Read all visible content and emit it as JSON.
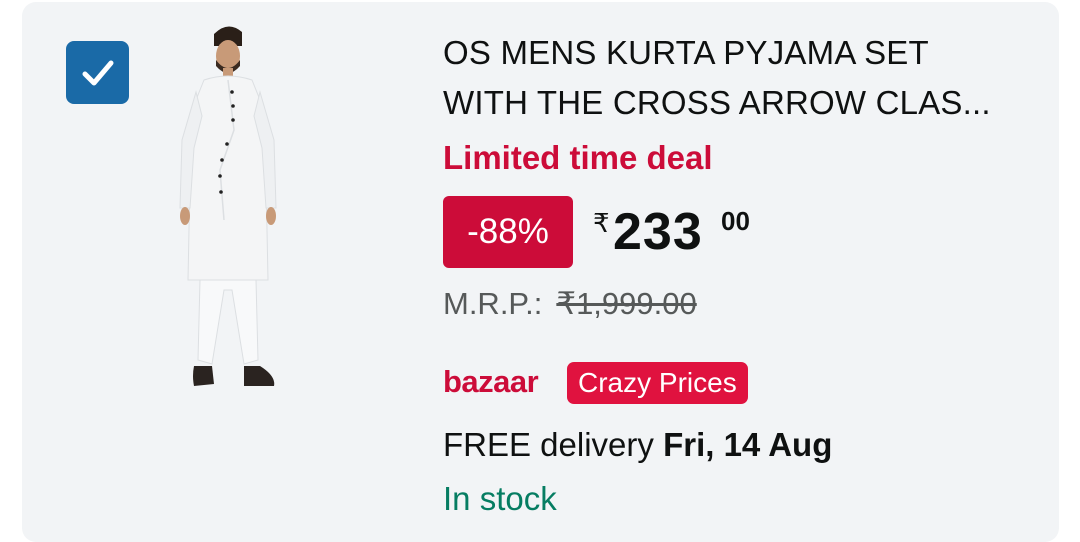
{
  "product": {
    "title_line1": "OS MENS KURTA PYJAMA SET",
    "title_line2": "WITH THE CROSS ARROW CLAS...",
    "deal_label": "Limited time deal",
    "discount": "-88%",
    "currency_symbol": "₹",
    "price_whole": "233",
    "price_fraction": "00",
    "mrp_label": "M.R.P.:",
    "mrp_value": "₹1,999.00",
    "bazaar_logo": "bazaar",
    "bazaar_badge": "Crazy Prices",
    "delivery_prefix": "FREE delivery",
    "delivery_date": "Fri, 14 Aug",
    "stock_status": "In stock",
    "selected": true
  },
  "icons": {
    "checkbox": "checkmark-icon",
    "image": "product-image"
  },
  "colors": {
    "deal_red": "#cc0c39",
    "checkbox_blue": "#1a6aa7",
    "stock_green": "#067d62",
    "card_bg": "#f2f4f6"
  }
}
